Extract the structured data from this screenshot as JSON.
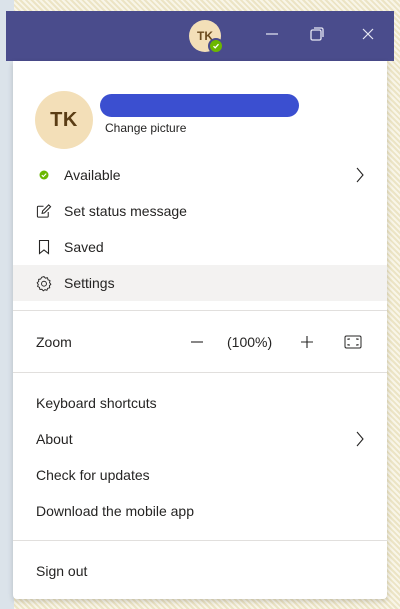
{
  "titlebar": {
    "avatar_initials": "TK",
    "status_color": "#6bb700",
    "bg_color": "#4a4c8c",
    "icons": [
      "minimize-icon",
      "restore-icon",
      "close-icon"
    ]
  },
  "profile": {
    "initials": "TK",
    "name_redacted_color": "#3b4fd0",
    "change_picture": "Change picture"
  },
  "status_items": [
    {
      "label": "Available",
      "icon": "available-dot-icon",
      "has_chevron": true
    },
    {
      "label": "Set status message",
      "icon": "edit-status-icon",
      "has_chevron": false
    },
    {
      "label": "Saved",
      "icon": "bookmark-icon",
      "has_chevron": false
    },
    {
      "label": "Settings",
      "icon": "gear-icon",
      "has_chevron": false,
      "active": true
    }
  ],
  "zoom": {
    "label": "Zoom",
    "minus": "—",
    "value": "(100%)",
    "plus": "+"
  },
  "help_items": [
    {
      "label": "Keyboard shortcuts",
      "has_chevron": false
    },
    {
      "label": "About",
      "has_chevron": true
    },
    {
      "label": "Check for updates",
      "has_chevron": false
    },
    {
      "label": "Download the mobile app",
      "has_chevron": false
    }
  ],
  "sign_out": "Sign out",
  "colors": {
    "available": "#6bb700",
    "hover_bg": "#f3f2f1",
    "divider": "#e1dfdd",
    "avatar_bg": "#f3dfb8"
  }
}
